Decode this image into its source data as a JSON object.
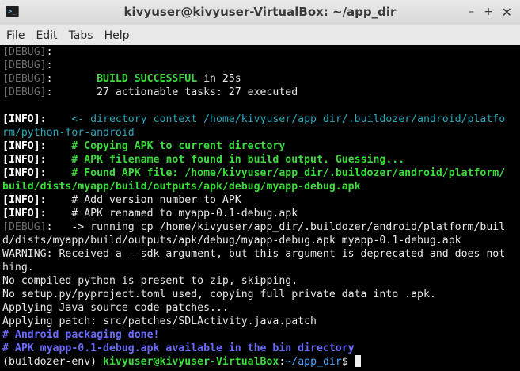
{
  "window": {
    "title": "kivyuser@kivyuser-VirtualBox: ~/app_dir",
    "icon_glyph": ">_",
    "controls": {
      "minimize": "–",
      "maximize": "+",
      "close": "✕"
    }
  },
  "menu": {
    "file": "File",
    "edit": "Edit",
    "tabs": "Tabs",
    "help": "Help"
  },
  "terminal": {
    "l1": {
      "tag": "[DEBUG]",
      "colon": ":",
      "text": ""
    },
    "l2": {
      "tag": "[DEBUG]",
      "colon": ":",
      "text": ""
    },
    "l3": {
      "tag": "[DEBUG]",
      "colon": ":",
      "pad": "       ",
      "text_a": "BUILD SUCCESSFUL",
      "text_b": " in 25s"
    },
    "l4": {
      "tag": "[DEBUG]",
      "colon": ":",
      "text": "       27 actionable tasks: 27 executed"
    },
    "l5": {
      "text": ""
    },
    "l6": {
      "tag": "[INFO]",
      "colon": ":",
      "text": "    <- directory context /home/kivyuser/app_dir/.buildozer/android/platfo"
    },
    "l7": {
      "text": "rm/python-for-android"
    },
    "l8": {
      "tag": "[INFO]",
      "colon": ":",
      "text": "    # Copying APK to current directory"
    },
    "l9": {
      "tag": "[INFO]",
      "colon": ":",
      "text": "    # APK filename not found in build output. Guessing..."
    },
    "l10": {
      "tag": "[INFO]",
      "colon": ":",
      "text": "    # Found APK file: /home/kivyuser/app_dir/.buildozer/android/platform/"
    },
    "l11": {
      "text": "build/dists/myapp/build/outputs/apk/debug/myapp-debug.apk"
    },
    "l12": {
      "tag": "[INFO]",
      "colon": ":",
      "text": "    # Add version number to APK"
    },
    "l13": {
      "tag": "[INFO]",
      "colon": ":",
      "text": "    # APK renamed to myapp-0.1-debug.apk"
    },
    "l14": {
      "tag": "[DEBUG]",
      "colon": ":",
      "text": "   -> running cp /home/kivyuser/app_dir/.buildozer/android/platform/buil"
    },
    "l15": {
      "text": "d/dists/myapp/build/outputs/apk/debug/myapp-debug.apk myapp-0.1-debug.apk"
    },
    "l16": {
      "text": "WARNING: Received a --sdk argument, but this argument is deprecated and does not"
    },
    "l17": {
      "text": "hing."
    },
    "l18": {
      "text": "No compiled python is present to zip, skipping."
    },
    "l19": {
      "text": "No setup.py/pyproject.toml used, copying full private data into .apk."
    },
    "l20": {
      "text": "Applying Java source code patches..."
    },
    "l21": {
      "text": "Applying patch: src/patches/SDLActivity.java.patch"
    },
    "l22": {
      "text": "# Android packaging done!"
    },
    "l23": {
      "text": "# APK myapp-0.1-debug.apk available in the bin directory"
    },
    "prompt": {
      "env": "(buildozer-env) ",
      "user_host": "kivyuser@kivyuser-VirtualBox",
      "sep": ":",
      "path": "~/app_dir",
      "dollar": "$ "
    }
  },
  "colors": {
    "debug_tag": "#6b6b6b",
    "info_tag": "#ffffff",
    "cyan": "#2aa7b8",
    "green": "#3ddc3d",
    "blue": "#6b6bff",
    "path": "#4aa8ff"
  }
}
